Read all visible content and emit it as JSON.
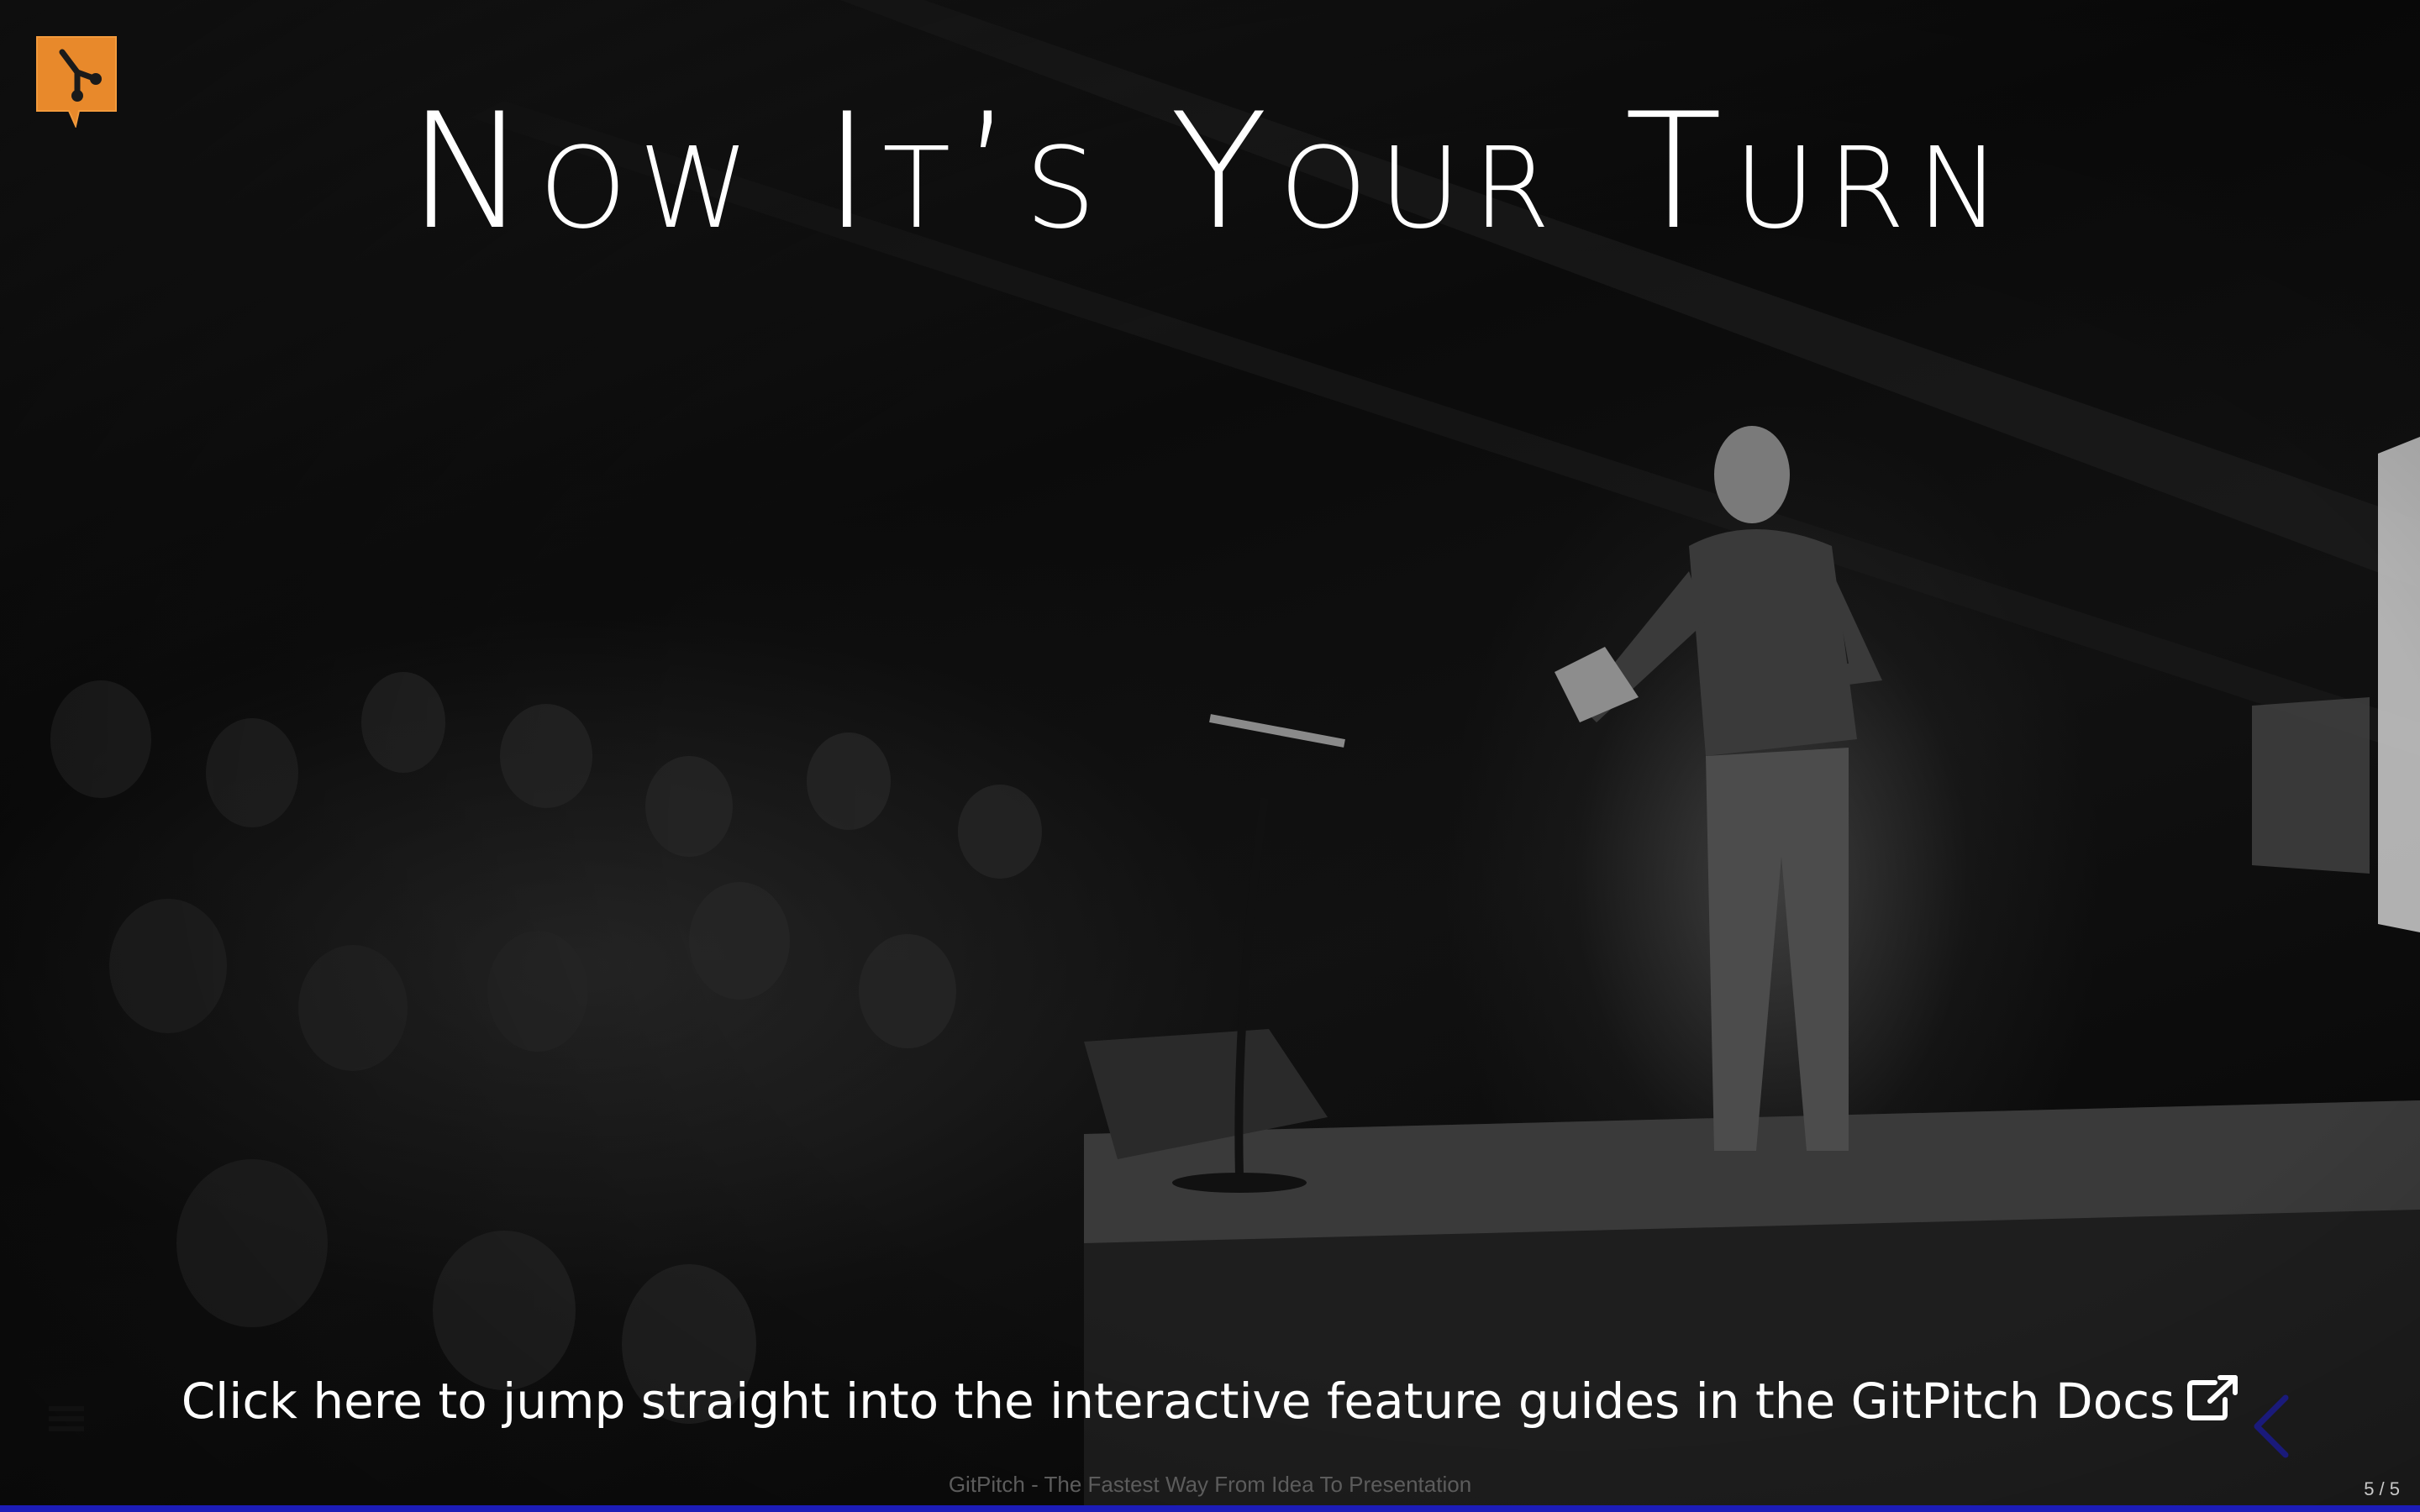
{
  "slide": {
    "title": "Now It’s Your Turn",
    "cta_text": "Click here to jump straight into the interactive feature guides in the GitPitch Docs",
    "footer_text": "GitPitch - The Fastest Way From Idea To Presentation",
    "slide_number": "5 / 5",
    "progress": 1.0
  },
  "icons": {
    "logo": "gitpitch-logo-icon",
    "external_link": "external-link-icon",
    "menu": "hamburger-menu-icon",
    "prev": "chevron-left-icon"
  },
  "colors": {
    "logo_orange": "#e8892b",
    "text": "#ffffff",
    "progress_bar": "#1c1cb8",
    "nav_arrow": "#1a1a7a"
  }
}
